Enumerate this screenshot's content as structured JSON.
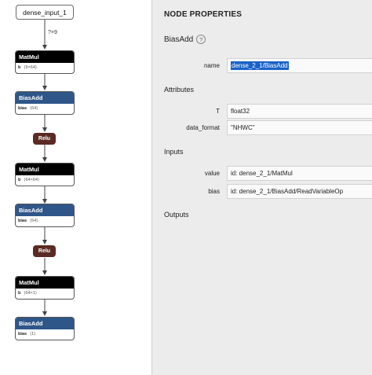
{
  "graph": {
    "input_node": "dense_input_1",
    "input_edge_label": "?×9",
    "nodes": [
      {
        "kind": "matmul",
        "op": "MatMul",
        "attr_name": "b",
        "attr_value": "⟨9×64⟩"
      },
      {
        "kind": "biasadd",
        "op": "BiasAdd",
        "attr_name": "bias",
        "attr_value": "⟨64⟩"
      },
      {
        "kind": "relu",
        "op": "Relu"
      },
      {
        "kind": "matmul",
        "op": "MatMul",
        "attr_name": "b",
        "attr_value": "⟨64×64⟩"
      },
      {
        "kind": "biasadd",
        "op": "BiasAdd",
        "attr_name": "bias",
        "attr_value": "⟨64⟩"
      },
      {
        "kind": "relu",
        "op": "Relu"
      },
      {
        "kind": "matmul",
        "op": "MatMul",
        "attr_name": "b",
        "attr_value": "⟨64×1⟩"
      },
      {
        "kind": "biasadd",
        "op": "BiasAdd",
        "attr_name": "bias",
        "attr_value": "⟨1⟩"
      }
    ]
  },
  "properties": {
    "panel_title": "NODE PROPERTIES",
    "op_name": "BiasAdd",
    "help_glyph": "?",
    "name_label": "name",
    "name_value": "dense_2_1/BiasAdd",
    "attributes_heading": "Attributes",
    "attr_t_label": "T",
    "attr_t_value": "float32",
    "attr_format_label": "data_format",
    "attr_format_value": "\"NHWC\"",
    "inputs_heading": "Inputs",
    "input_value_label": "value",
    "input_value_value": "id: dense_2_1/MatMul",
    "input_bias_label": "bias",
    "input_bias_value": "id: dense_2_1/BiasAdd/ReadVariableOp",
    "outputs_heading": "Outputs"
  }
}
